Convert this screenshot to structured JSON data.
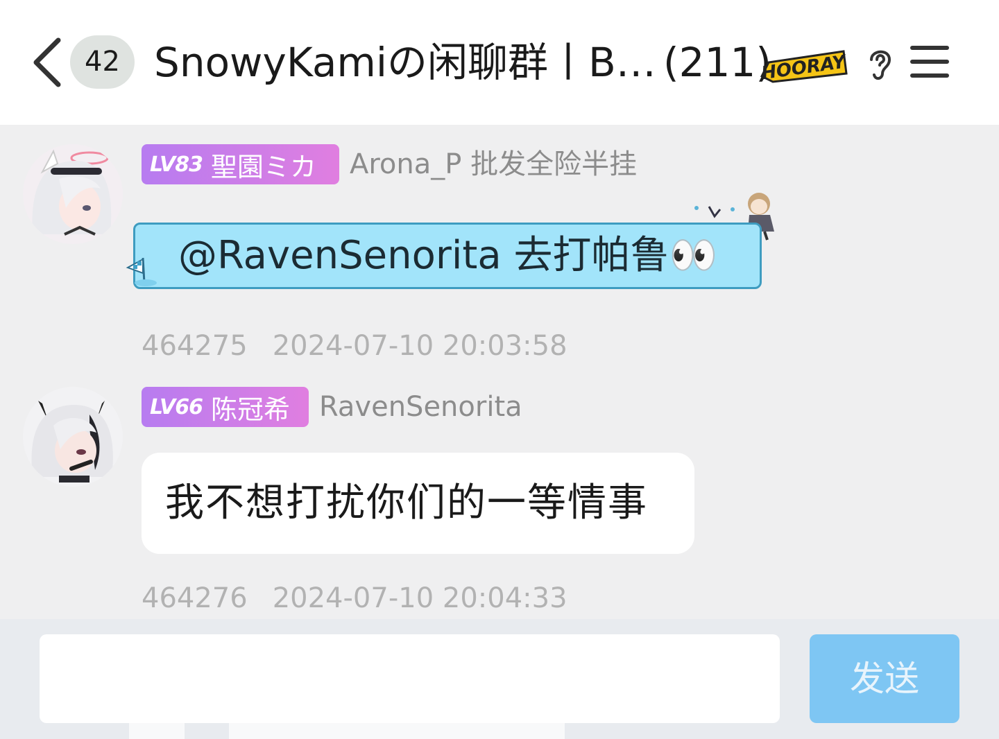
{
  "header": {
    "back_icon": "chevron-left-icon",
    "unread_badge": "42",
    "title": "SnowyKamiの闲聊群丨B…",
    "member_count": "(211)",
    "hooray_text": "HOORAY",
    "ear_icon": "ear-icon",
    "menu_icon": "menu-icon"
  },
  "messages": [
    {
      "level": "LV83",
      "title_name": "聖園ミカ",
      "sender": "Arona_P 批发全险半挂",
      "text": "@RavenSenorita 去打帕鲁👀",
      "id": "464275",
      "time": "2024-07-10 20:03:58"
    },
    {
      "level": "LV66",
      "title_name": "陈冠希",
      "sender": "RavenSenorita",
      "text": "我不想打扰你们的一等情事",
      "id": "464276",
      "time": "2024-07-10 20:04:33"
    }
  ],
  "input": {
    "value": "",
    "placeholder": "",
    "send_label": "发送"
  },
  "colors": {
    "tag_gradient_start": "#b77cf0",
    "tag_gradient_end": "#e07ee0",
    "special_bubble": "#a2e4fa",
    "send_button": "#7ec6f3"
  }
}
